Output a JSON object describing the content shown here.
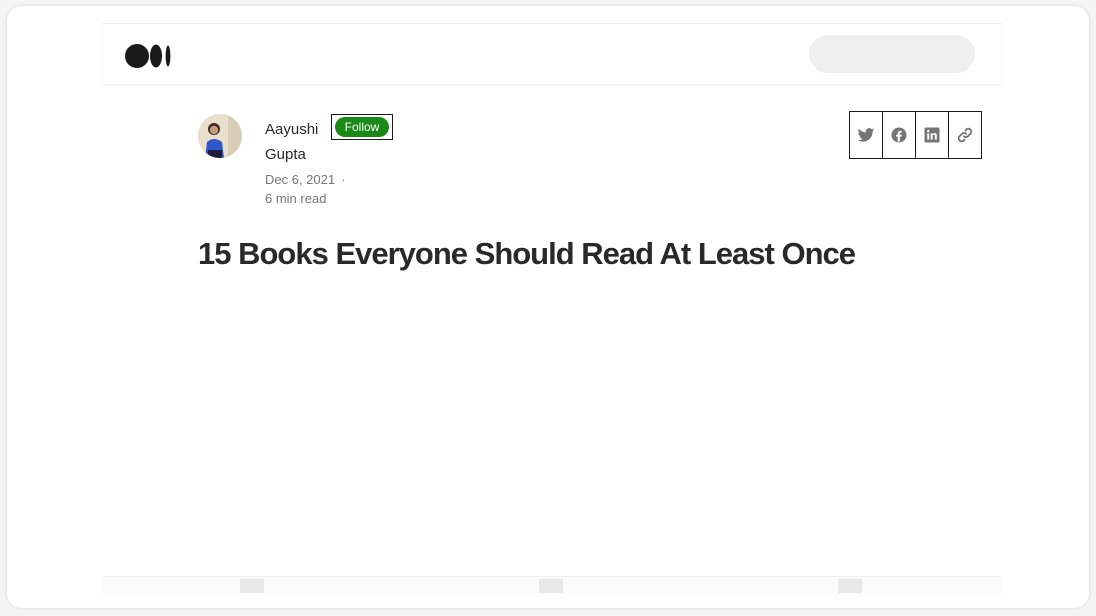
{
  "author": {
    "first_name": "Aayushi",
    "last_name": "Gupta",
    "follow_label": "Follow"
  },
  "meta": {
    "date": "Dec 6, 2021",
    "separator": "·",
    "read_time": "6 min read"
  },
  "article": {
    "title": "15 Books Everyone Should Read At Least Once"
  },
  "icons": {
    "logo": "medium-logo-icon",
    "share": [
      "twitter-icon",
      "facebook-icon",
      "linkedin-icon",
      "link-icon"
    ]
  },
  "colors": {
    "follow_green": "#1a8917",
    "text_dark": "#292929",
    "text_muted": "#757575",
    "icon_gray": "#757575"
  }
}
